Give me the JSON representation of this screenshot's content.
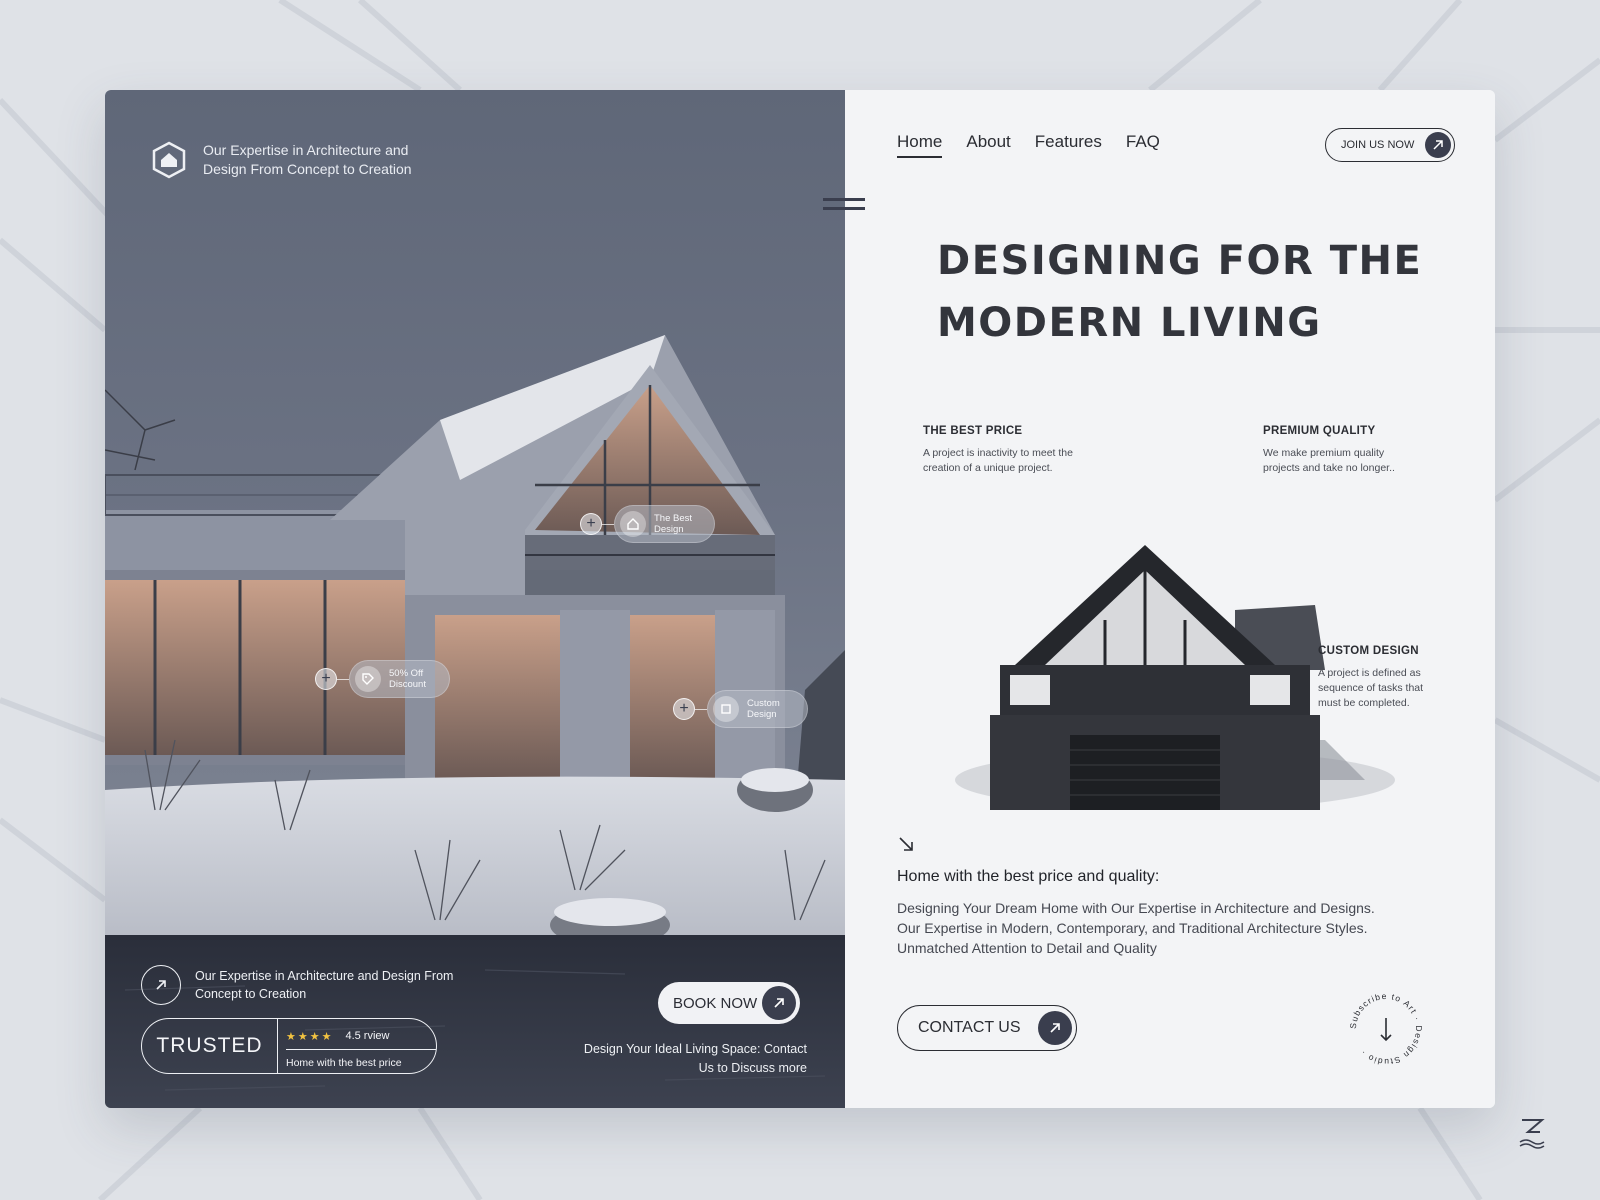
{
  "brand": {
    "tagline": "Our Expertise in Architecture and Design From Concept to Creation"
  },
  "hotspots": [
    {
      "label": "The Best Design",
      "icon": "home-icon"
    },
    {
      "label": "50% Off Discount",
      "icon": "tag-icon"
    },
    {
      "label": "Custom Design",
      "icon": "crop-icon"
    }
  ],
  "left_footer": {
    "expertise_text": "Our Expertise in Architecture and Design From Concept to Creation",
    "trusted_label": "TRUSTED",
    "stars": "★★★★",
    "rating": "4.5 rview",
    "rating_sub": "Home with the best price",
    "book_label": "BOOK NOW",
    "cta_text": "Design Your Ideal Living Space: Contact Us to Discuss more"
  },
  "nav": {
    "items": [
      "Home",
      "About",
      "Features",
      "FAQ"
    ],
    "active": "Home",
    "join_label": "JOIN US NOW"
  },
  "hero": {
    "title_line1": "DESIGNING FOR THE",
    "title_line2": "MODERN LIVING"
  },
  "features": [
    {
      "title": "THE BEST PRICE",
      "desc": "A project is inactivity to meet the creation of a unique project."
    },
    {
      "title": "PREMIUM QUALITY",
      "desc": "We make premium quality projects and take no longer.."
    },
    {
      "title": "CUSTOM DESIGN",
      "desc": "A project is defined as sequence of tasks that must be completed."
    }
  ],
  "info": {
    "title": "Home with the best price and quality:",
    "desc": "Designing Your Dream Home with Our Expertise in Architecture and Designs. Our Expertise in Modern, Contemporary, and Traditional Architecture Styles. Unmatched Attention to Detail and Quality",
    "contact_label": "CONTACT US",
    "badge_text": "Subscribe to Art · Design Studio ·"
  },
  "colors": {
    "accent_dark": "#3a3e4e",
    "panel_light": "#f3f4f6",
    "star": "#f2c341"
  }
}
